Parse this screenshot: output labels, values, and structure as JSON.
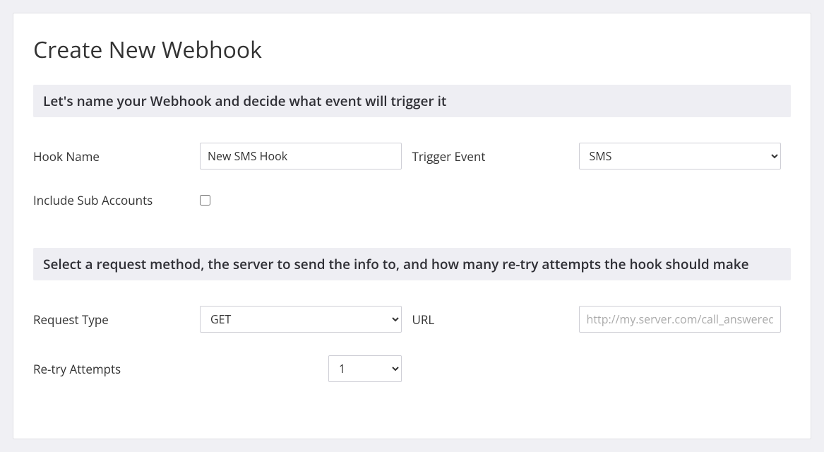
{
  "pageTitle": "Create New Webhook",
  "section1": {
    "header": "Let's name your Webhook and decide what event will trigger it",
    "hookNameLabel": "Hook Name",
    "hookNameValue": "New SMS Hook",
    "triggerEventLabel": "Trigger Event",
    "triggerEventValue": "SMS",
    "includeSubLabel": "Include Sub Accounts"
  },
  "section2": {
    "header": "Select a request method, the server to send the info to, and how many re-try attempts the hook should make",
    "requestTypeLabel": "Request Type",
    "requestTypeValue": "GET",
    "urlLabel": "URL",
    "urlPlaceholder": "http://my.server.com/call_answered",
    "retryLabel": "Re-try Attempts",
    "retryValue": "1"
  }
}
